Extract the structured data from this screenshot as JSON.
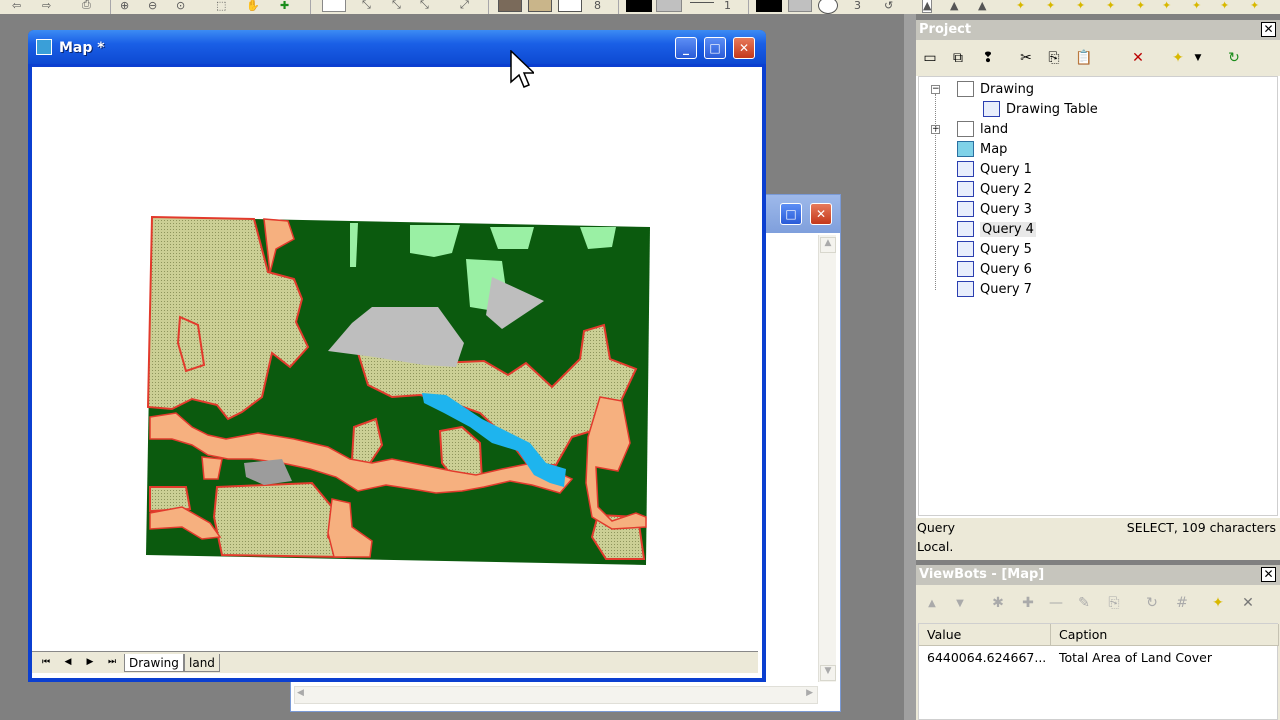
{
  "map_window": {
    "title": "Map *",
    "tabs": [
      "Drawing",
      "land"
    ]
  },
  "project_panel": {
    "title": "Project",
    "close_glyph": "✕",
    "tree": [
      {
        "label": "Drawing",
        "icon": "drawing-icon"
      },
      {
        "label": "Drawing Table",
        "icon": "table-icon"
      },
      {
        "label": "land",
        "icon": "drawing-icon"
      },
      {
        "label": "Map",
        "icon": "map-icon"
      },
      {
        "label": "Query 1",
        "icon": "query-icon"
      },
      {
        "label": "Query 2",
        "icon": "query-icon"
      },
      {
        "label": "Query 3",
        "icon": "query-icon"
      },
      {
        "label": "Query 4",
        "icon": "query-icon",
        "selected": true
      },
      {
        "label": "Query 5",
        "icon": "query-icon"
      },
      {
        "label": "Query 6",
        "icon": "query-icon"
      },
      {
        "label": "Query 7",
        "icon": "query-icon"
      }
    ],
    "status": {
      "type": "Query",
      "detail": "SELECT, 109 characters",
      "location": "Local."
    }
  },
  "viewbots_panel": {
    "title": "ViewBots - [Map]",
    "close_glyph": "✕",
    "columns": [
      "Value",
      "Caption"
    ],
    "rows": [
      {
        "value": "6440064.624667...",
        "caption": "Total Area of Land Cover"
      }
    ]
  },
  "toolbar": {
    "numbers": [
      "8",
      "1",
      "3"
    ]
  },
  "colors": {
    "forest": "#0b5a0e",
    "agriculture": "#cbcf95",
    "bare": "#f6b07f",
    "grass": "#9af0a4",
    "rock": "#bebebe",
    "water": "#1eb4ee",
    "boundary": "#e23a2c"
  }
}
